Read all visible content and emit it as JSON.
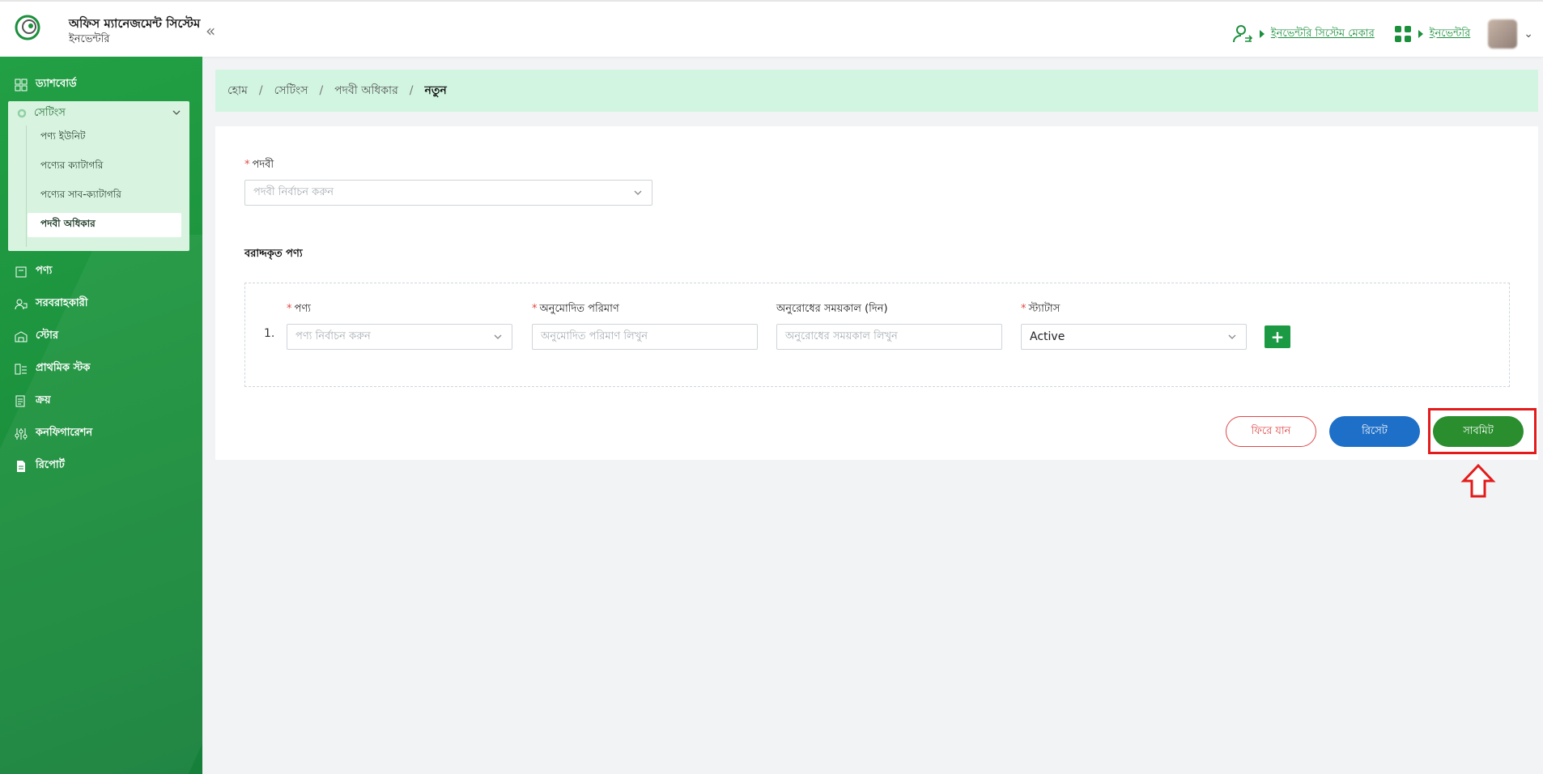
{
  "header": {
    "app_title": "অফিস ম্যানেজমেন্ট সিস্টেম",
    "app_subtitle": "ইনভেন্টরি",
    "user_role_link": "ইনভেন্টরি সিস্টেম মেকার",
    "module_link": "ইনভেন্টরি"
  },
  "sidebar": {
    "items": [
      {
        "label": "ড্যাশবোর্ড"
      },
      {
        "label": "সেটিংস"
      },
      {
        "label": "পণ্য"
      },
      {
        "label": "সরবরাহকারী"
      },
      {
        "label": "স্টোর"
      },
      {
        "label": "প্রাথমিক স্টক"
      },
      {
        "label": "ক্রয়"
      },
      {
        "label": "কনফিগারেশন"
      },
      {
        "label": "রিপোর্ট"
      }
    ],
    "settings_sub": [
      {
        "label": "পণ্য ইউনিট"
      },
      {
        "label": "পণ্যের ক্যাটাগরি"
      },
      {
        "label": "পণ্যের সাব-ক্যাটাগরি"
      },
      {
        "label": "পদবী অধিকার"
      }
    ]
  },
  "breadcrumb": {
    "items": [
      "হোম",
      "সেটিংস",
      "পদবী অধিকার"
    ],
    "current": "নতুন"
  },
  "form": {
    "designation_label": "পদবী",
    "designation_placeholder": "পদবী নির্বাচন করুন",
    "allocated_title": "বরাদ্দকৃত পণ্য",
    "row_number": "1.",
    "product_label": "পণ্য",
    "product_placeholder": "পণ্য নির্বাচন করুন",
    "approved_qty_label": "অনুমোদিত পরিমাণ",
    "approved_qty_placeholder": "অনুমোদিত পরিমাণ লিখুন",
    "request_period_label": "অনুরোধের সময়কাল (দিন)",
    "request_period_placeholder": "অনুরোধের সময়কাল লিখুন",
    "status_label": "স্ট্যাটাস",
    "status_value": "Active"
  },
  "buttons": {
    "back": "ফিরে যান",
    "reset": "রিসেট",
    "submit": "সাবমিট"
  },
  "colors": {
    "brand_green": "#1b8f3c",
    "breadcrumb_bg": "#d1f5e0",
    "reset_blue": "#1e6fc7",
    "back_red": "#e04848",
    "highlight_red": "#e31b1b"
  }
}
